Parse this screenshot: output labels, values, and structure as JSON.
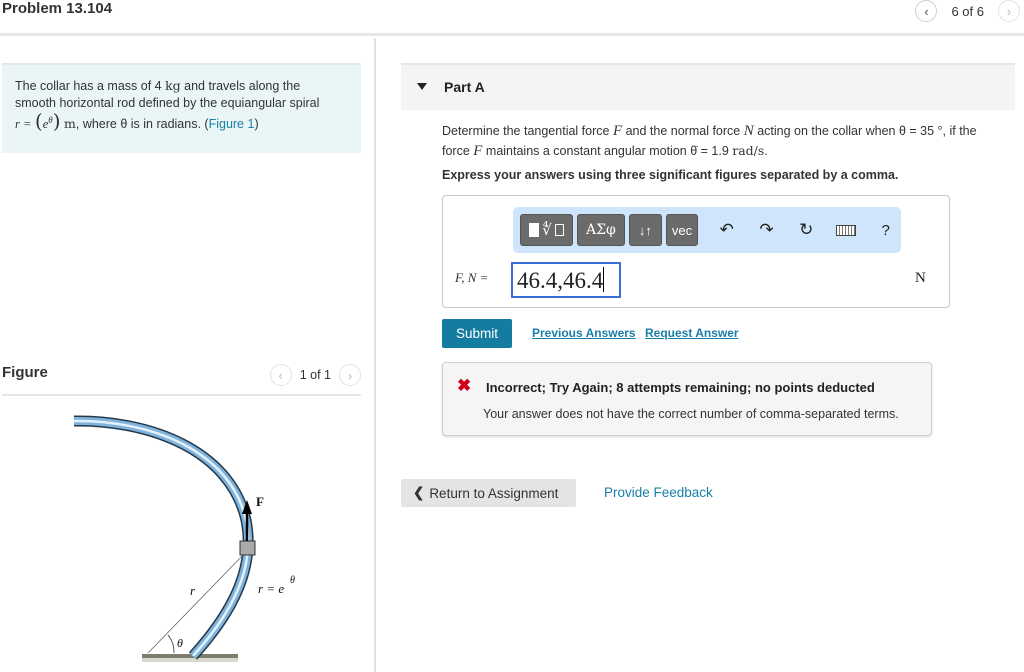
{
  "header": {
    "problem_title": "Problem 13.104",
    "pager_text": "6 of 6",
    "prev_icon": "chevron-left-icon",
    "next_icon": "chevron-right-icon"
  },
  "intro": {
    "line1_pre": "The collar has a mass of 4 ",
    "line1_unit": "kg",
    "line1_post": " and travels along the",
    "line2": "smooth horizontal rod defined by the equiangular spiral",
    "eq_lhs": "r =",
    "eq_rhs": "e",
    "eq_sup": "θ",
    "eq_unit": "m",
    "line3_post": ", where θ is in radians. (",
    "figure_link": "Figure 1",
    "line3_close": ")"
  },
  "figure": {
    "title": "Figure",
    "pager_text": "1 of 1",
    "labels": {
      "force": "F",
      "radius": "r",
      "equation": "r = e",
      "equation_sup": "θ",
      "angle": "θ"
    }
  },
  "part": {
    "title": "Part A",
    "question_l1_a": "Determine the tangential force ",
    "question_F": "F",
    "question_l1_b": " and the normal force ",
    "question_N": "N",
    "question_l1_c": " acting on the collar when θ = 35 °, if the",
    "question_l2_a": "force ",
    "question_l2_b": " maintains a constant angular motion θ̇ = 1.9 ",
    "question_l2_unit": "rad/s",
    "question_l2_end": ".",
    "instruction": "Express your answers using three significant figures separated by a comma."
  },
  "answer": {
    "toolbar": {
      "templates_icon": "fraction-root-icon",
      "greek_label": "ΑΣφ",
      "arrows_label": "↓↑",
      "vec_label": "vec",
      "undo_icon": "undo-icon",
      "redo_icon": "redo-icon",
      "reset_icon": "reset-icon",
      "keyboard_icon": "keyboard-icon",
      "help_label": "?"
    },
    "label": "F, N =",
    "value": "46.4,46.4",
    "units": "N"
  },
  "actions": {
    "submit": "Submit",
    "previous_answers": "Previous Answers",
    "request_answer": "Request Answer"
  },
  "feedback": {
    "icon": "✖",
    "title": "Incorrect; Try Again; 8 attempts remaining; no points deducted",
    "message": "Your answer does not have the correct number of comma-separated terms."
  },
  "footer": {
    "return_label": "Return to Assignment",
    "provide_feedback": "Provide Feedback"
  },
  "colors": {
    "accent": "#137ca0",
    "link": "#1a7fa8",
    "error": "#d0021b",
    "intro_bg": "#eaf6f6",
    "toolbar_bg": "#cfe5fb"
  }
}
